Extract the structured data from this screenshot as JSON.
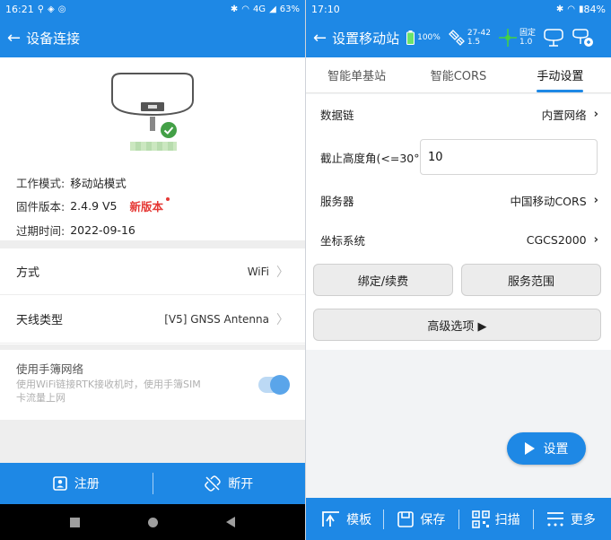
{
  "left": {
    "status": {
      "time": "16:21",
      "network": "4G",
      "battery": "63%"
    },
    "title": "设备连接",
    "info": {
      "work_mode_label": "工作模式:",
      "work_mode_value": "移动站模式",
      "firmware_label": "固件版本:",
      "firmware_value": "2.4.9 V5",
      "new_version": "新版本",
      "expire_label": "过期时间:",
      "expire_value": "2022-09-16"
    },
    "rows": {
      "method_label": "方式",
      "method_value": "WiFi",
      "antenna_label": "天线类型",
      "antenna_value": "[V5] GNSS Antenna"
    },
    "phone_network": {
      "title": "使用手簿网络",
      "description": "使用WiFi链接RTK接收机时，使用手簿SIM卡流量上网",
      "enabled": true
    },
    "bottom": {
      "register": "注册",
      "disconnect": "断开"
    }
  },
  "right": {
    "status": {
      "time": "17:10",
      "battery": "84%"
    },
    "title": "设置移动站",
    "indicators": {
      "battery": "100%",
      "satellites": "27-42",
      "pdop": "1.5",
      "fix": "固定",
      "fix_value": "1.0"
    },
    "tabs": [
      "智能单基站",
      "智能CORS",
      "手动设置"
    ],
    "active_tab": 2,
    "fields": {
      "datalink_label": "数据链",
      "datalink_value": "内置网络",
      "cutoff_label": "截止高度角(<=30°)",
      "cutoff_value": "10",
      "server_label": "服务器",
      "server_value": "中国移动CORS",
      "coord_label": "坐标系统",
      "coord_value": "CGCS2000"
    },
    "buttons": {
      "bind": "绑定/续费",
      "coverage": "服务范围",
      "advanced": "高级选项 ▶",
      "set": "设置"
    },
    "bottom": {
      "template": "模板",
      "save": "保存",
      "scan": "扫描",
      "more": "更多"
    }
  },
  "colors": {
    "primary": "#1e88e5",
    "danger": "#e53935",
    "success": "#43a047"
  }
}
